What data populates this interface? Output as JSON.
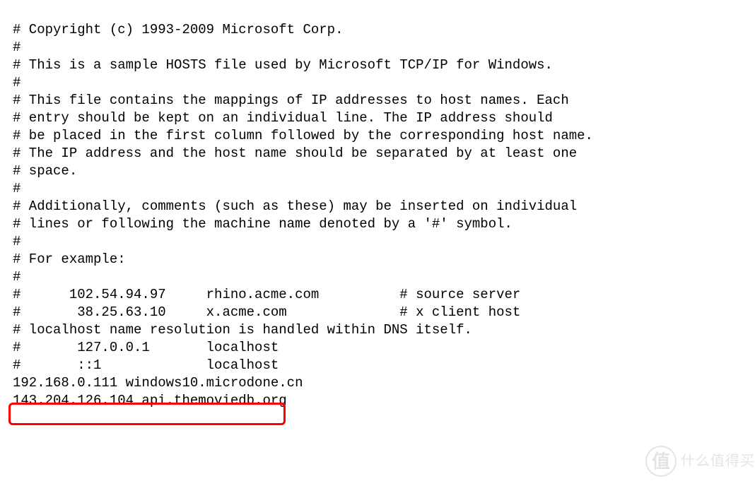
{
  "lines": [
    "# Copyright (c) 1993-2009 Microsoft Corp.",
    "#",
    "# This is a sample HOSTS file used by Microsoft TCP/IP for Windows.",
    "#",
    "# This file contains the mappings of IP addresses to host names. Each",
    "# entry should be kept on an individual line. The IP address should",
    "# be placed in the first column followed by the corresponding host name.",
    "# The IP address and the host name should be separated by at least one",
    "# space.",
    "#",
    "# Additionally, comments (such as these) may be inserted on individual",
    "# lines or following the machine name denoted by a '#' symbol.",
    "#",
    "# For example:",
    "#",
    "#      102.54.94.97     rhino.acme.com          # source server",
    "#       38.25.63.10     x.acme.com              # x client host",
    "",
    "# localhost name resolution is handled within DNS itself.",
    "#       127.0.0.1       localhost",
    "#       ::1             localhost",
    "192.168.0.111 windows10.microdone.cn",
    "143.204.126.104 api.themoviedb.org"
  ],
  "highlighted_entry": {
    "ip": "143.204.126.104",
    "host": "api.themoviedb.org"
  },
  "watermark": {
    "symbol": "值",
    "text": "什么值得买"
  }
}
